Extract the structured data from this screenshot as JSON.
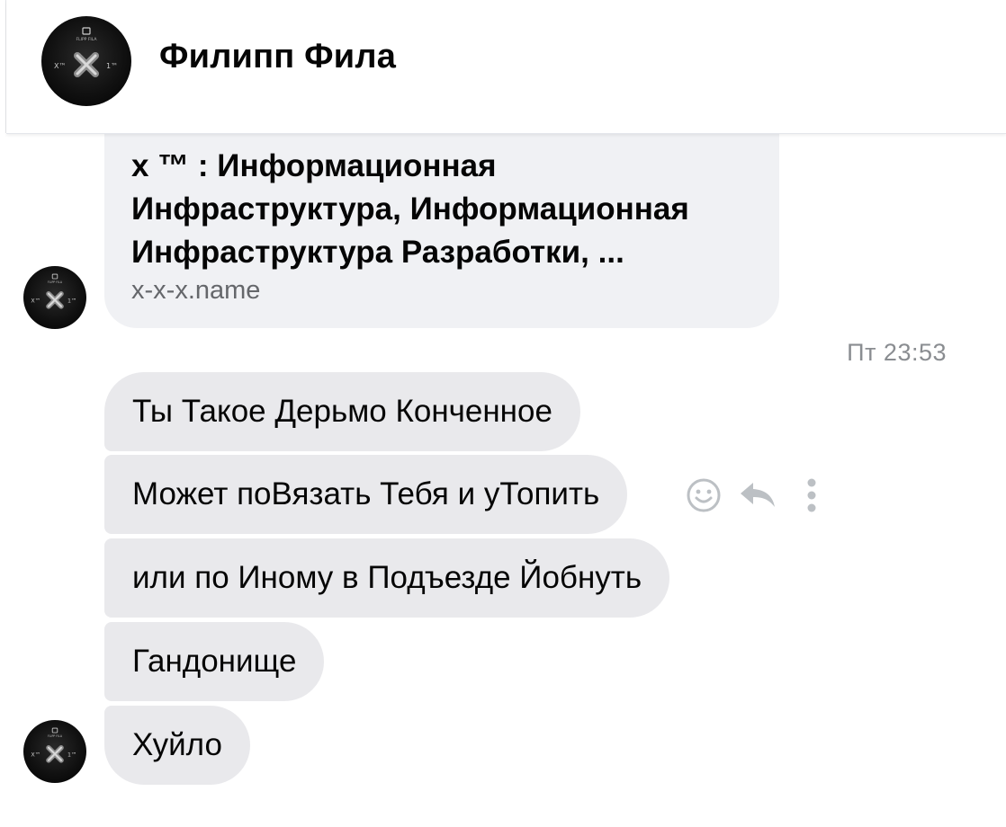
{
  "header": {
    "contact_name": "Филипп Фила"
  },
  "link_preview": {
    "title": "x ™ : Информационная Инфраструктура, Информационная Инфраструктура Разработки, ...",
    "domain": "x-x-x.name"
  },
  "timestamp": "Пт 23:53",
  "messages": [
    {
      "text": "Ты Такое Дерьмо Конченное"
    },
    {
      "text": "Может поВязать Тебя и уТопить"
    },
    {
      "text": "или по Иному в Подъезде Йобнуть"
    },
    {
      "text": "Гандонище"
    },
    {
      "text": "Хуйло"
    }
  ],
  "hover_actions": {
    "icons": [
      "smiley-reaction-icon",
      "reply-arrow-icon",
      "more-vertical-icon"
    ]
  },
  "colors": {
    "bubble_bg": "#e9e9ec",
    "link_bg": "#f0f1f4",
    "icon": "#bcc0c4",
    "timestamp": "#8a8d91"
  },
  "avatar": {
    "logo_text_top": "FLIPP FILA",
    "logo_text_left": "X™",
    "logo_text_right": "1™"
  }
}
